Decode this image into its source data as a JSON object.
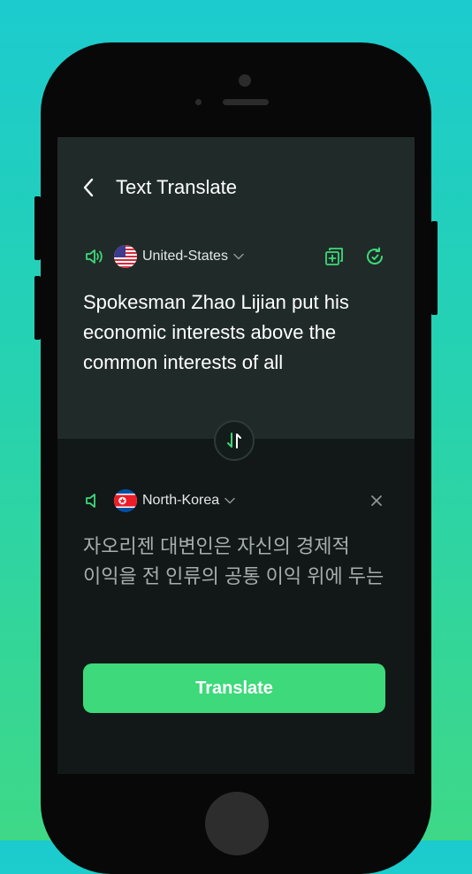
{
  "header": {
    "title": "Text Translate"
  },
  "source": {
    "language": "United-States",
    "text": "Spokesman Zhao Lijian put his economic interests above the common interests of all"
  },
  "target": {
    "language": "North-Korea",
    "text": "자오리젠 대변인은 자신의 경제적 이익을 전 인류의 공통 이익 위에 두는"
  },
  "actions": {
    "translate_label": "Translate"
  },
  "colors": {
    "accent": "#3dd97a",
    "panel_top": "#202b29",
    "panel_bottom": "#111817"
  }
}
